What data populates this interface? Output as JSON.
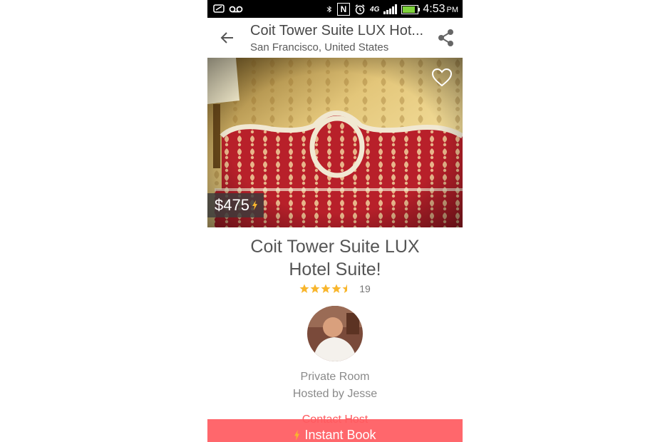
{
  "status_bar": {
    "time": "4:53",
    "ampm": "PM",
    "network": "4G",
    "icons": [
      "voicemail-icon",
      "notification-icon",
      "bluetooth-icon",
      "nfc-icon",
      "alarm-icon",
      "lte-icon",
      "signal-icon",
      "battery-icon"
    ]
  },
  "toolbar": {
    "title": "Coit Tower Suite LUX Hot...",
    "subtitle": "San Francisco, United States"
  },
  "hero": {
    "price": "$475",
    "instant_book_badge": "bolt-icon"
  },
  "listing": {
    "title_line1": "Coit Tower Suite LUX",
    "title_line2": "Hotel Suite!",
    "rating": 4.5,
    "rating_max": 5,
    "review_count": "19",
    "room_type": "Private Room",
    "hosted_by": "Hosted by Jesse",
    "contact_host": "Contact Host"
  },
  "cta": {
    "label": "Instant Book"
  },
  "colors": {
    "brand": "#ff5a5f",
    "star": "#f8b62d",
    "status_bar": "#000000"
  }
}
